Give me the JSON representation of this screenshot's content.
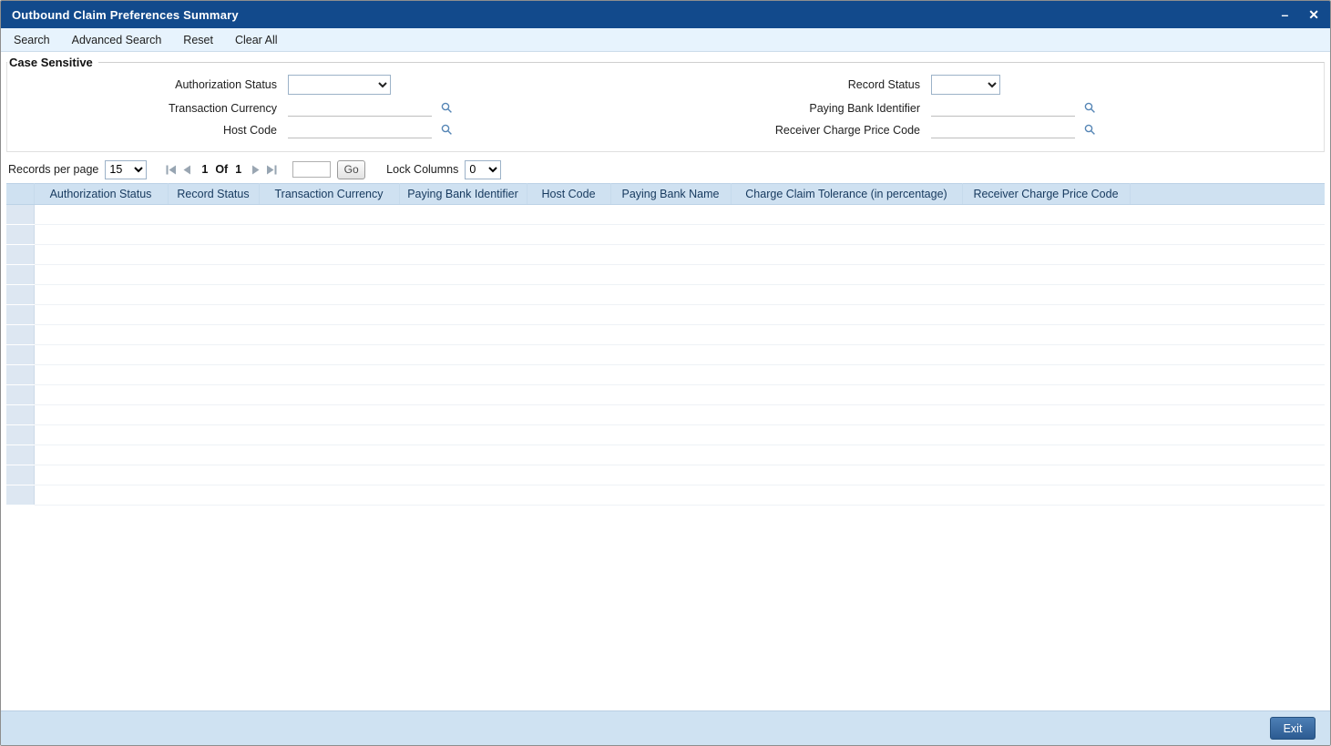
{
  "window": {
    "title": "Outbound Claim Preferences Summary",
    "minimize_glyph": "–",
    "close_glyph": "✕"
  },
  "toolbar": {
    "items": [
      "Search",
      "Advanced Search",
      "Reset",
      "Clear All"
    ]
  },
  "search": {
    "group_label": "Case Sensitive",
    "fields": {
      "authorization_status": {
        "label": "Authorization Status",
        "value": ""
      },
      "record_status": {
        "label": "Record Status",
        "value": ""
      },
      "transaction_currency": {
        "label": "Transaction Currency",
        "value": ""
      },
      "paying_bank_identifier": {
        "label": "Paying Bank Identifier",
        "value": ""
      },
      "host_code": {
        "label": "Host Code",
        "value": ""
      },
      "receiver_charge_price_code": {
        "label": "Receiver Charge Price Code",
        "value": ""
      }
    }
  },
  "pagination": {
    "records_per_page_label": "Records per page",
    "records_per_page_value": "15",
    "current_page": "1",
    "of_label": "Of",
    "total_pages": "1",
    "goto_value": "",
    "go_label": "Go",
    "lock_columns_label": "Lock Columns",
    "lock_columns_value": "0"
  },
  "table": {
    "headers": [
      "Authorization Status",
      "Record Status",
      "Transaction Currency",
      "Paying Bank Identifier",
      "Host Code",
      "Paying Bank Name",
      "Charge Claim Tolerance (in percentage)",
      "Receiver Charge Price Code"
    ],
    "empty_row_count": 15
  },
  "footer": {
    "exit_label": "Exit"
  },
  "colors": {
    "titlebar": "#124a8c",
    "toolbar_bg": "#e7f3fd",
    "table_header_bg": "#cfe1f1",
    "footer_bg": "#cfe2f2",
    "accent_blue": "#2c5b92"
  }
}
